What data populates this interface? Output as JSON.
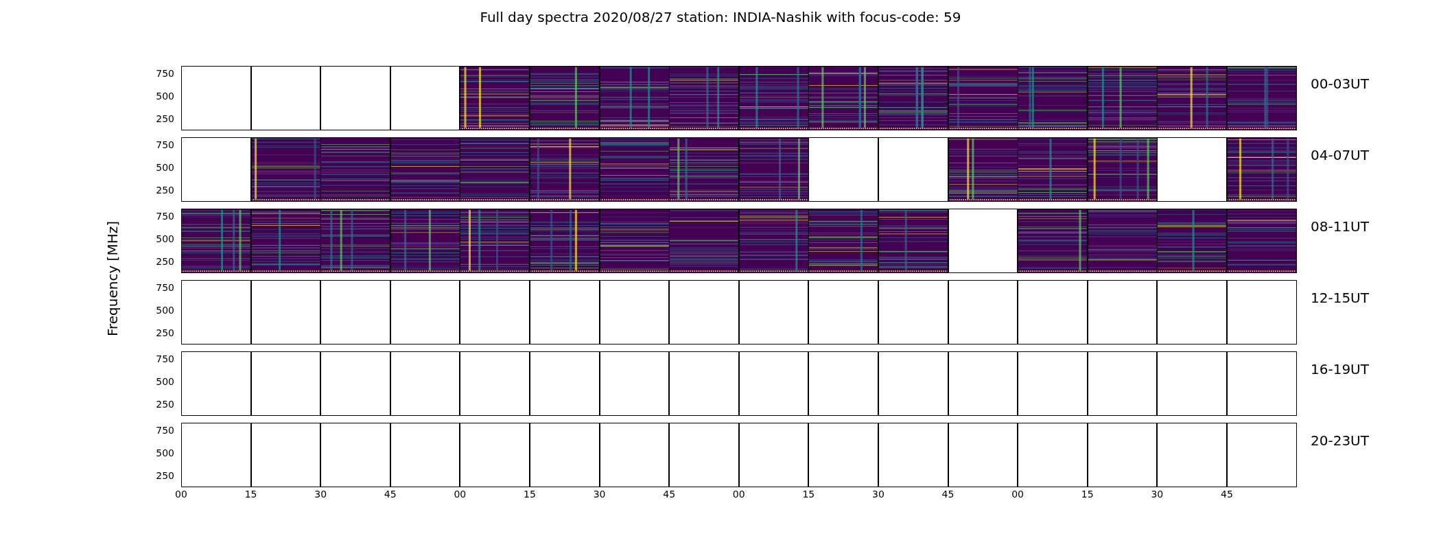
{
  "title": "Full day spectra 2020/08/27 station: INDIA-Nashik with focus-code: 59",
  "ylabel": "Frequency [MHz]",
  "xticks": [
    "00",
    "15",
    "30",
    "45",
    "00",
    "15",
    "30",
    "45",
    "00",
    "15",
    "30",
    "45",
    "00",
    "15",
    "30",
    "45"
  ],
  "rows": [
    {
      "label": "00-03UT",
      "yticks": [
        "750",
        "500",
        "250"
      ],
      "panels": [
        {
          "has_data": false
        },
        {
          "has_data": false
        },
        {
          "has_data": false
        },
        {
          "has_data": false
        },
        {
          "has_data": true
        },
        {
          "has_data": true
        },
        {
          "has_data": true
        },
        {
          "has_data": true
        },
        {
          "has_data": true
        },
        {
          "has_data": true
        },
        {
          "has_data": true
        },
        {
          "has_data": true
        },
        {
          "has_data": true
        },
        {
          "has_data": true
        },
        {
          "has_data": true
        },
        {
          "has_data": true
        }
      ]
    },
    {
      "label": "04-07UT",
      "yticks": [
        "750",
        "500",
        "250"
      ],
      "panels": [
        {
          "has_data": false
        },
        {
          "has_data": true
        },
        {
          "has_data": true
        },
        {
          "has_data": true
        },
        {
          "has_data": true
        },
        {
          "has_data": true
        },
        {
          "has_data": true
        },
        {
          "has_data": true
        },
        {
          "has_data": true
        },
        {
          "has_data": false
        },
        {
          "has_data": false
        },
        {
          "has_data": true
        },
        {
          "has_data": true
        },
        {
          "has_data": true
        },
        {
          "has_data": false
        },
        {
          "has_data": true
        }
      ]
    },
    {
      "label": "08-11UT",
      "yticks": [
        "750",
        "500",
        "250"
      ],
      "panels": [
        {
          "has_data": true
        },
        {
          "has_data": true
        },
        {
          "has_data": true
        },
        {
          "has_data": true
        },
        {
          "has_data": true
        },
        {
          "has_data": true
        },
        {
          "has_data": true
        },
        {
          "has_data": true
        },
        {
          "has_data": true
        },
        {
          "has_data": true
        },
        {
          "has_data": true
        },
        {
          "has_data": false
        },
        {
          "has_data": true
        },
        {
          "has_data": true
        },
        {
          "has_data": true
        },
        {
          "has_data": true
        }
      ]
    },
    {
      "label": "12-15UT",
      "yticks": [
        "750",
        "500",
        "250"
      ],
      "panels": [
        {
          "has_data": false
        },
        {
          "has_data": false
        },
        {
          "has_data": false
        },
        {
          "has_data": false
        },
        {
          "has_data": false
        },
        {
          "has_data": false
        },
        {
          "has_data": false
        },
        {
          "has_data": false
        },
        {
          "has_data": false
        },
        {
          "has_data": false
        },
        {
          "has_data": false
        },
        {
          "has_data": false
        },
        {
          "has_data": false
        },
        {
          "has_data": false
        },
        {
          "has_data": false
        },
        {
          "has_data": false
        }
      ]
    },
    {
      "label": "16-19UT",
      "yticks": [
        "750",
        "500",
        "250"
      ],
      "panels": [
        {
          "has_data": false
        },
        {
          "has_data": false
        },
        {
          "has_data": false
        },
        {
          "has_data": false
        },
        {
          "has_data": false
        },
        {
          "has_data": false
        },
        {
          "has_data": false
        },
        {
          "has_data": false
        },
        {
          "has_data": false
        },
        {
          "has_data": false
        },
        {
          "has_data": false
        },
        {
          "has_data": false
        },
        {
          "has_data": false
        },
        {
          "has_data": false
        },
        {
          "has_data": false
        },
        {
          "has_data": false
        }
      ]
    },
    {
      "label": "20-23UT",
      "yticks": [
        "750",
        "500",
        "250"
      ],
      "panels": [
        {
          "has_data": false
        },
        {
          "has_data": false
        },
        {
          "has_data": false
        },
        {
          "has_data": false
        },
        {
          "has_data": false
        },
        {
          "has_data": false
        },
        {
          "has_data": false
        },
        {
          "has_data": false
        },
        {
          "has_data": false
        },
        {
          "has_data": false
        },
        {
          "has_data": false
        },
        {
          "has_data": false
        },
        {
          "has_data": false
        },
        {
          "has_data": false
        },
        {
          "has_data": false
        },
        {
          "has_data": false
        }
      ]
    }
  ]
}
